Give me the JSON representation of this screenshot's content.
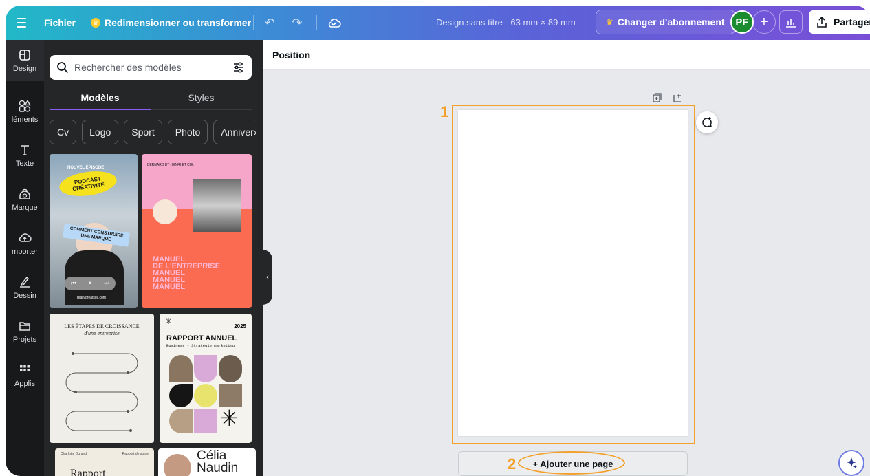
{
  "topbar": {
    "file_label": "Fichier",
    "resize_label": "Redimensionner ou transformer",
    "doc_title": "Design sans titre - 63 mm × 89 mm",
    "upgrade_label": "Changer d'abonnement",
    "avatar_initials": "PF",
    "add_member": "+",
    "share_label": "Partager"
  },
  "rail": {
    "items": [
      {
        "label": "Design",
        "icon": "layout-icon"
      },
      {
        "label": "léments",
        "icon": "shapes-icon"
      },
      {
        "label": "Texte",
        "icon": "text-icon"
      },
      {
        "label": "Marque",
        "icon": "brand-icon"
      },
      {
        "label": "mporter",
        "icon": "upload-icon"
      },
      {
        "label": "Dessin",
        "icon": "draw-icon"
      },
      {
        "label": "Projets",
        "icon": "folder-icon"
      },
      {
        "label": "Applis",
        "icon": "apps-icon"
      }
    ]
  },
  "panel": {
    "search_placeholder": "Rechercher des modèles",
    "tabs": [
      "Modèles",
      "Styles"
    ],
    "chips": [
      "Cv",
      "Logo",
      "Sport",
      "Photo",
      "Anniver"
    ],
    "templates": {
      "podcast": {
        "tag": "NOUVEL ÉPISODE",
        "headline": "PODCAST CRÉATIVITÉ",
        "sub": "COMMENT CONSTRUIRE UNE MARQUE",
        "url": "reallygreatsite.com"
      },
      "manuel": {
        "header": "BERNARD ET HENRI ET CIE.",
        "lines": [
          "MANUEL",
          "DE L'ENTREPRISE",
          "MANUEL",
          "MANUEL",
          "MANUEL"
        ]
      },
      "croissance": {
        "title": "LES ÉTAPES DE CROISSANCE",
        "subtitle": "d'une entreprise"
      },
      "rapport": {
        "year": "2025",
        "title": "RAPPORT ANNUEL",
        "subtitle": "Business - Stratégie marketing"
      },
      "rapport2": {
        "left": "Charlotte Durand",
        "right": "Rapport de stage",
        "title": "Rapport"
      },
      "celia": {
        "name1": "Célia",
        "name2": "Naudin"
      }
    }
  },
  "canvas": {
    "toolbar_label": "Position",
    "annotation_1": "1",
    "annotation_2": "2",
    "add_page_label": "+ Ajouter une page"
  },
  "colors": {
    "accent": "#8b5cf6",
    "highlight": "#f3a12b",
    "avatar": "#1a8b2f"
  }
}
